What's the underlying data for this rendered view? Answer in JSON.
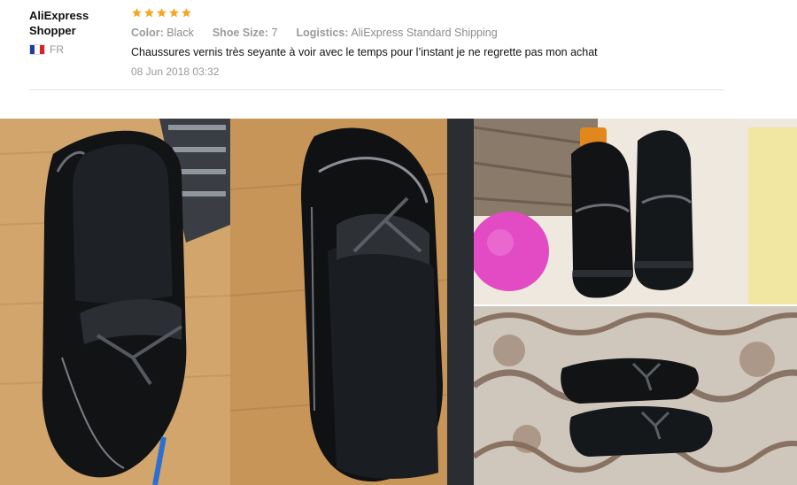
{
  "review": {
    "user_name": "AliExpress Shopper",
    "country_code": "FR",
    "rating": 5,
    "star_color": "#f5a623",
    "attributes": [
      {
        "key": "Color:",
        "value": "Black"
      },
      {
        "key": "Shoe Size:",
        "value": "7"
      },
      {
        "key": "Logistics:",
        "value": "AliExpress Standard Shipping"
      }
    ],
    "comment": "Chaussures vernis très seyante à voir avec le temps pour l’instant je ne regrette pas mon achat",
    "date": "08 Jun 2018 03:32"
  },
  "photos": [
    {
      "name": "shoe-top-view-photo"
    },
    {
      "name": "shoe-angled-photo"
    },
    {
      "name": "shoe-pair-on-sofa-photo"
    },
    {
      "name": "shoe-pair-on-rug-photo"
    }
  ]
}
